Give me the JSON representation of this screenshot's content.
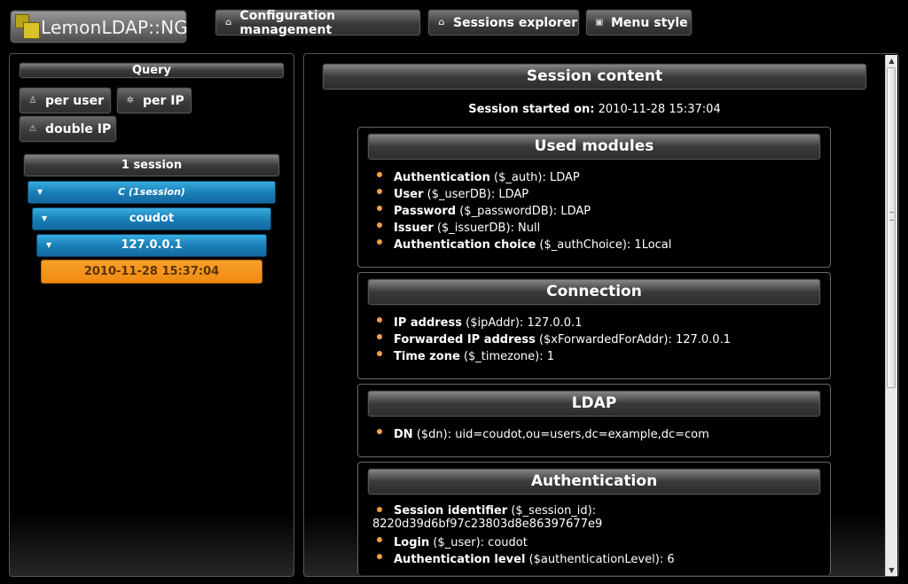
{
  "header": {
    "logo_text": "LemonLDAP::NG",
    "buttons": [
      {
        "label": "Configuration management",
        "icon": "home-icon"
      },
      {
        "label": "Sessions explorer",
        "icon": "home-icon"
      },
      {
        "label": "Menu style",
        "icon": "image-icon"
      }
    ]
  },
  "sidebar": {
    "query_title": "Query",
    "query_buttons": [
      {
        "label": "per user",
        "icon": "user-icon"
      },
      {
        "label": "per IP",
        "icon": "network-icon"
      },
      {
        "label": "double IP",
        "icon": "warning-icon"
      }
    ],
    "session_count": "1 session",
    "tree": [
      {
        "label": "C (1session)",
        "level": 1
      },
      {
        "label": "coudot",
        "level": 2
      },
      {
        "label": "127.0.0.1",
        "level": 3
      }
    ],
    "selected_session": "2010-11-28 15:37:04"
  },
  "content": {
    "title": "Session content",
    "started_label": "Session started on:",
    "started_value": "2010-11-28 15:37:04",
    "sections": [
      {
        "title": "Used modules",
        "items": [
          {
            "label": "Authentication",
            "var": "($_auth):",
            "value": "LDAP"
          },
          {
            "label": "User",
            "var": "($_userDB):",
            "value": "LDAP"
          },
          {
            "label": "Password",
            "var": "($_passwordDB):",
            "value": "LDAP"
          },
          {
            "label": "Issuer",
            "var": "($_issuerDB):",
            "value": "Null"
          },
          {
            "label": "Authentication choice",
            "var": "($_authChoice):",
            "value": "1Local"
          }
        ]
      },
      {
        "title": "Connection",
        "items": [
          {
            "label": "IP address",
            "var": "($ipAddr):",
            "value": "127.0.0.1"
          },
          {
            "label": "Forwarded IP address",
            "var": "($xForwardedForAddr):",
            "value": "127.0.0.1"
          },
          {
            "label": "Time zone",
            "var": "($_timezone):",
            "value": "1"
          }
        ]
      },
      {
        "title": "LDAP",
        "items": [
          {
            "label": "DN",
            "var": "($dn):",
            "value": "uid=coudot,ou=users,dc=example,dc=com"
          }
        ]
      },
      {
        "title": "Authentication",
        "items": [
          {
            "label": "Session identifier",
            "var": "($_session_id):",
            "value": "8220d39d6bf97c23803d8e86397677e9"
          },
          {
            "label": "Login",
            "var": "($_user):",
            "value": "coudot"
          },
          {
            "label": "Authentication level",
            "var": "($authenticationLevel):",
            "value": "6"
          }
        ]
      }
    ]
  },
  "colors": {
    "tree_blue": "#1a7fb8",
    "selected_orange": "#f08a10",
    "bullet": "#f2a04a"
  }
}
